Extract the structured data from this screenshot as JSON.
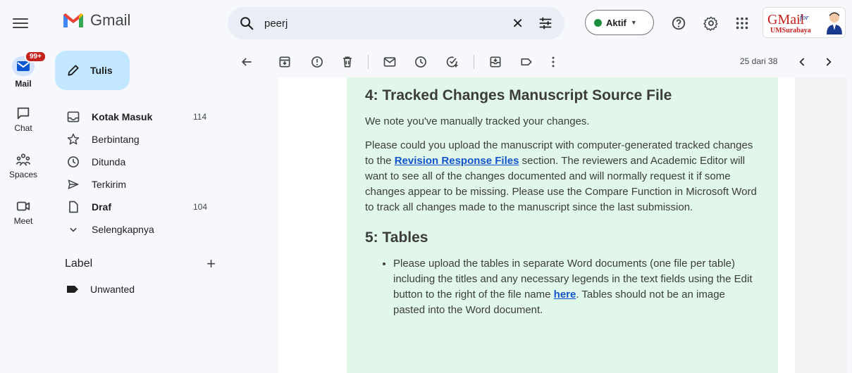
{
  "app": {
    "name": "Gmail"
  },
  "search": {
    "value": "peerj"
  },
  "status": {
    "label": "Aktif"
  },
  "brand": {
    "logo_text": "GMail",
    "for": "for",
    "sub": "UMSurabaya"
  },
  "rail": {
    "mail": "Mail",
    "mail_badge": "99+",
    "chat": "Chat",
    "spaces": "Spaces",
    "meet": "Meet"
  },
  "compose": {
    "label": "Tulis"
  },
  "nav": [
    {
      "label": "Kotak Masuk",
      "count": "114",
      "icon": "inbox-icon"
    },
    {
      "label": "Berbintang",
      "count": "",
      "icon": "star-icon"
    },
    {
      "label": "Ditunda",
      "count": "",
      "icon": "clock-icon"
    },
    {
      "label": "Terkirim",
      "count": "",
      "icon": "send-icon"
    },
    {
      "label": "Draf",
      "count": "104",
      "icon": "draft-icon"
    },
    {
      "label": "Selengkapnya",
      "count": "",
      "icon": "chevron-down-icon"
    }
  ],
  "labels": {
    "title": "Label",
    "items": [
      "Unwanted"
    ]
  },
  "pager": {
    "text": "25 dari 38"
  },
  "email": {
    "h4": "4: Tracked Changes Manuscript Source File",
    "p1": "We note you've manually tracked your changes.",
    "p2a": "Please could you upload the manuscript with computer-generated tracked changes to the ",
    "p2link": "Revision Response Files",
    "p2b": " section. The reviewers and Academic Editor will want to see all of the changes documented and will normally request it if some changes appear to be missing. Please use the Compare Function in Microsoft Word to track all changes made to the manuscript since the last submission.",
    "h5": "5: Tables",
    "li1a": "Please upload the tables in separate Word documents (one file per table) including the titles and any necessary legends in the text fields using the Edit button to the right of the file name ",
    "li1link": "here",
    "li1b": ". Tables should not be an image pasted into the Word document."
  },
  "colors": {
    "accent": "#c2e7ff",
    "sheet": "#e1f7ea",
    "link": "#1155cc",
    "badge": "#c5221f"
  }
}
